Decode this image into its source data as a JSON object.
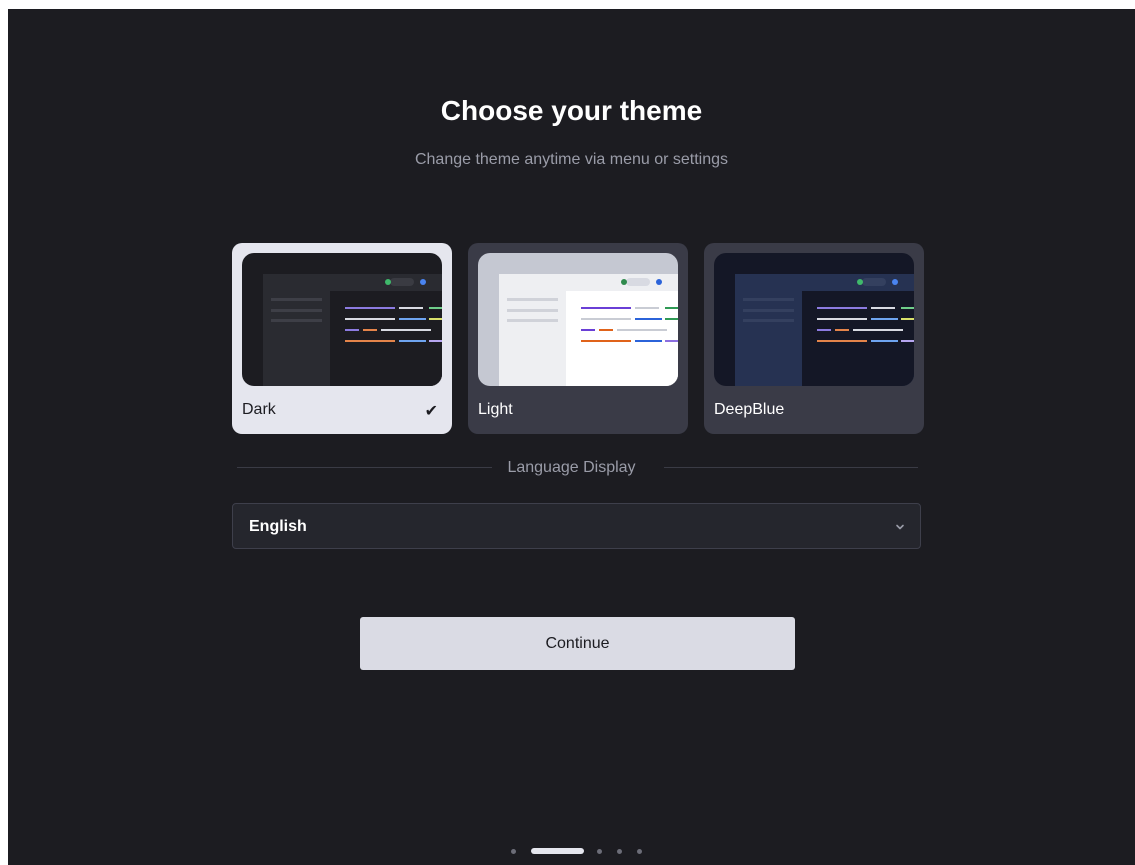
{
  "header": {
    "title": "Choose your theme",
    "subtitle": "Change theme anytime via menu or settings"
  },
  "themes": [
    {
      "label": "Dark",
      "selected": true,
      "check": "✔",
      "preview_colors": {
        "outer": "#2a2b31",
        "sidebar": "#2a2b31",
        "editor": "#1c1c21",
        "toolbar": "#2a2b31",
        "pill": "#3a3b42"
      }
    },
    {
      "label": "Light",
      "selected": false,
      "preview_colors": {
        "outer": "#c5c8d2",
        "sidebar": "#eeeff2",
        "editor": "#ffffff",
        "toolbar": "#eeeff2",
        "pill": "#d8dae2"
      }
    },
    {
      "label": "DeepBlue",
      "selected": false,
      "preview_colors": {
        "outer": "#1a1d2c",
        "sidebar": "#263252",
        "editor": "#141726",
        "toolbar": "#263252",
        "pill": "#34405f"
      }
    }
  ],
  "language": {
    "divider_label": "Language Display",
    "selected": "English"
  },
  "continue_label": "Continue",
  "pagination": {
    "total": 5,
    "active_index": 1
  },
  "colors": {
    "background": "#1c1c21",
    "card": "#3a3b47",
    "card_selected": "#e5e6ee",
    "button": "#dadbe4"
  }
}
